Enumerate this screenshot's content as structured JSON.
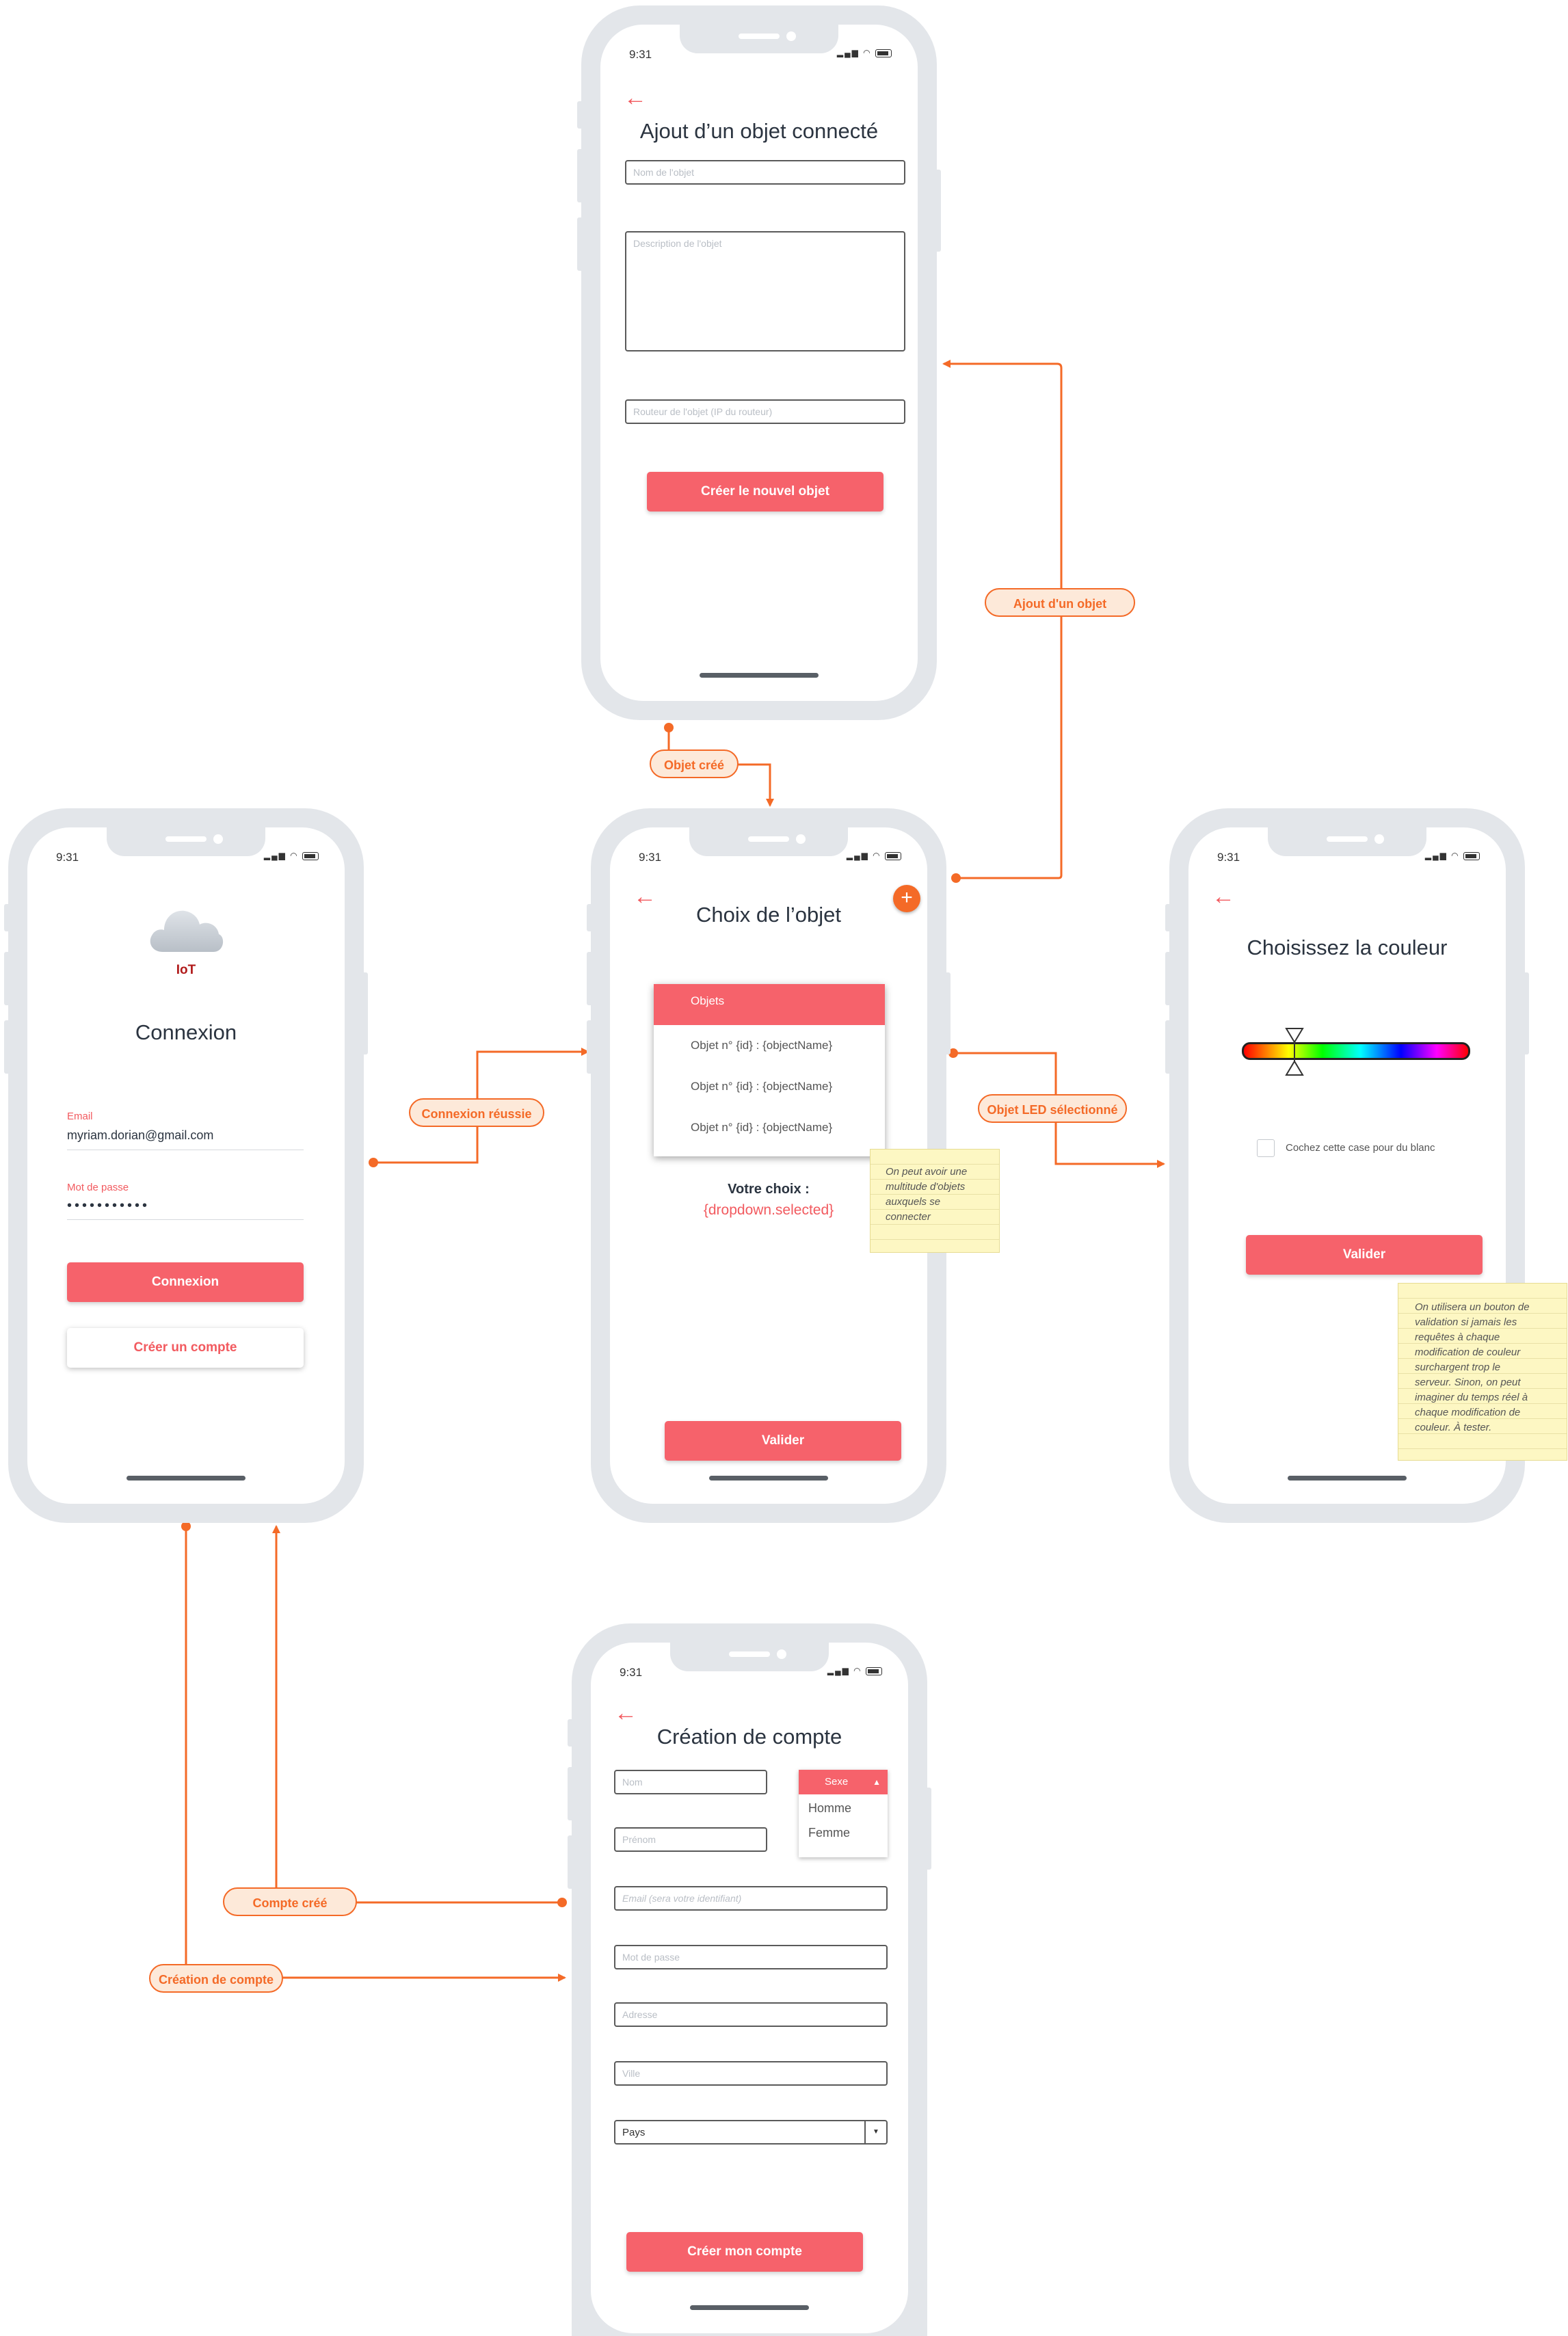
{
  "status_time": "9:31",
  "back_arrow": "←",
  "add_icon": "+",
  "screens": {
    "add_object": {
      "title": "Ajout d’un objet connecté",
      "name_placeholder": "Nom de l'objet",
      "description_placeholder": "Description de l'objet",
      "router_placeholder": "Routeur de l'objet (IP du routeur)",
      "create_button": "Créer le nouvel objet"
    },
    "login": {
      "logo_text": "IoT",
      "title": "Connexion",
      "email_label": "Email",
      "email_value": "myriam.dorian@gmail.com",
      "password_label": "Mot de passe",
      "password_value": "•••••••••••",
      "login_button": "Connexion",
      "create_account_button": "Créer un compte"
    },
    "choose_object": {
      "title": "Choix de l’objet",
      "dropdown_header": "Objets",
      "options": [
        "Objet n° {id} : {objectName}",
        "Objet n° {id} : {objectName}",
        "Objet n° {id} : {objectName}"
      ],
      "choice_label": "Votre choix :",
      "choice_value": "{dropdown.selected}",
      "validate_button": "Valider"
    },
    "choose_color": {
      "title": "Choisissez la couleur",
      "checkbox_label": "Cochez cette case pour du blanc",
      "validate_button": "Valider"
    },
    "create_account": {
      "title": "Création de compte",
      "nom_placeholder": "Nom",
      "prenom_placeholder": "Prénom",
      "sexe_label": "Sexe",
      "sexe_options": [
        "Homme",
        "Femme"
      ],
      "email_placeholder": "Email (sera votre identifiant)",
      "password_placeholder": "Mot de passe",
      "address_placeholder": "Adresse",
      "city_placeholder": "Ville",
      "country_value": "Pays",
      "submit_button": "Créer mon compte"
    }
  },
  "connectors": {
    "objet_cree": "Objet créé",
    "ajout_objet": "Ajout d'un objet",
    "connexion_reussie": "Connexion réussie",
    "objet_led": "Objet LED sélectionné",
    "compte_cree": "Compte créé",
    "creation_compte": "Création de compte"
  },
  "notes": {
    "choose_object_note": [
      "On peut avoir une",
      "multitude d'objets",
      "auxquels se",
      "connecter"
    ],
    "color_note": [
      "On utilisera un bouton de",
      "validation si jamais les",
      "requêtes à chaque",
      "modification de couleur",
      "surchargent trop le",
      "serveur. Sinon, on peut",
      "imaginer du temps réel à",
      "chaque modification de",
      "couleur. À tester."
    ]
  },
  "colors": {
    "accent": "#f6626b",
    "connector": "#f46a27",
    "phone_frame": "#e3e6ea"
  }
}
